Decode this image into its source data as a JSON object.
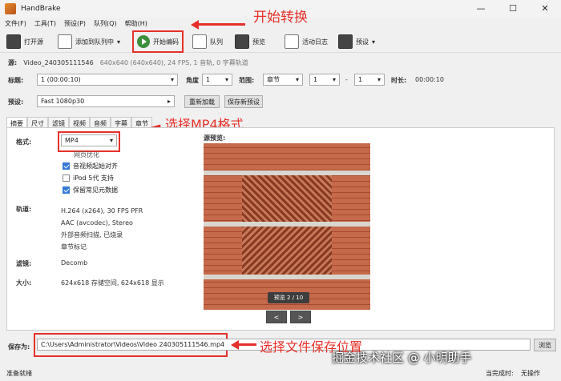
{
  "window": {
    "title": "HandBrake"
  },
  "menu": [
    "文件(F)",
    "工具(T)",
    "预设(P)",
    "队列(Q)",
    "帮助(H)"
  ],
  "toolbar": {
    "open_source": "打开源",
    "add_to_queue": "添加到队列中",
    "start_encode": "开始编码",
    "queue": "队列",
    "preview": "预览",
    "activity_log": "活动日志",
    "presets": "预设"
  },
  "annotations": {
    "start": "开始转换",
    "mp4": "选择MP4格式",
    "save": "选择文件保存位置"
  },
  "source": {
    "label": "源:",
    "name": "Video_240305111546",
    "info": "640x640 (640x640), 24 FPS, 1 音轨, 0 字幕轨道"
  },
  "title_row": {
    "title_label": "标题:",
    "title_value": "1 (00:00:10)",
    "angle_label": "角度",
    "angle_value": "1",
    "range_label": "范围:",
    "range_value": "章节",
    "range_from": "1",
    "range_dash": "-",
    "range_to": "1",
    "duration_label": "时长:",
    "duration_value": "00:00:10"
  },
  "preset_row": {
    "label": "预设:",
    "value": "Fast 1080p30",
    "reload": "重新加载",
    "save_new": "保存新预设"
  },
  "tabs": [
    "摘要",
    "尺寸",
    "滤镜",
    "视频",
    "音频",
    "字幕",
    "章节"
  ],
  "summary": {
    "format_label": "格式:",
    "format_value": "MP4",
    "web_optimized": "网页优化",
    "align_av": "音视频起始对齐",
    "ipod": "iPod 5代 支持",
    "passthru_meta": "保留常见元数据",
    "tracks_label": "轨道:",
    "tracks": [
      "H.264 (x264), 30 FPS PFR",
      "AAC (avcodec), Stereo",
      "外部音频扫描, 已烧录",
      "章节标记"
    ],
    "filters_label": "滤镜:",
    "filters_value": "Decomb",
    "size_label": "大小:",
    "size_value": "624x618 存储空间, 624x618 显示",
    "preview_label": "源预览:",
    "preview_badge": "预览 2 / 10",
    "prev": "<",
    "next": ">"
  },
  "save": {
    "label": "保存为:",
    "path": "C:\\Users\\Administrator\\Videos\\Video 240305111546.mp4",
    "browse": "浏览"
  },
  "status": {
    "left": "准备就绪",
    "when_done_label": "当完成时:",
    "when_done_value": "无操作"
  },
  "watermark": "掘金技术社区 @ 小明助手",
  "colors": {
    "annotation": "#e5312a",
    "accent": "#3478d4"
  }
}
